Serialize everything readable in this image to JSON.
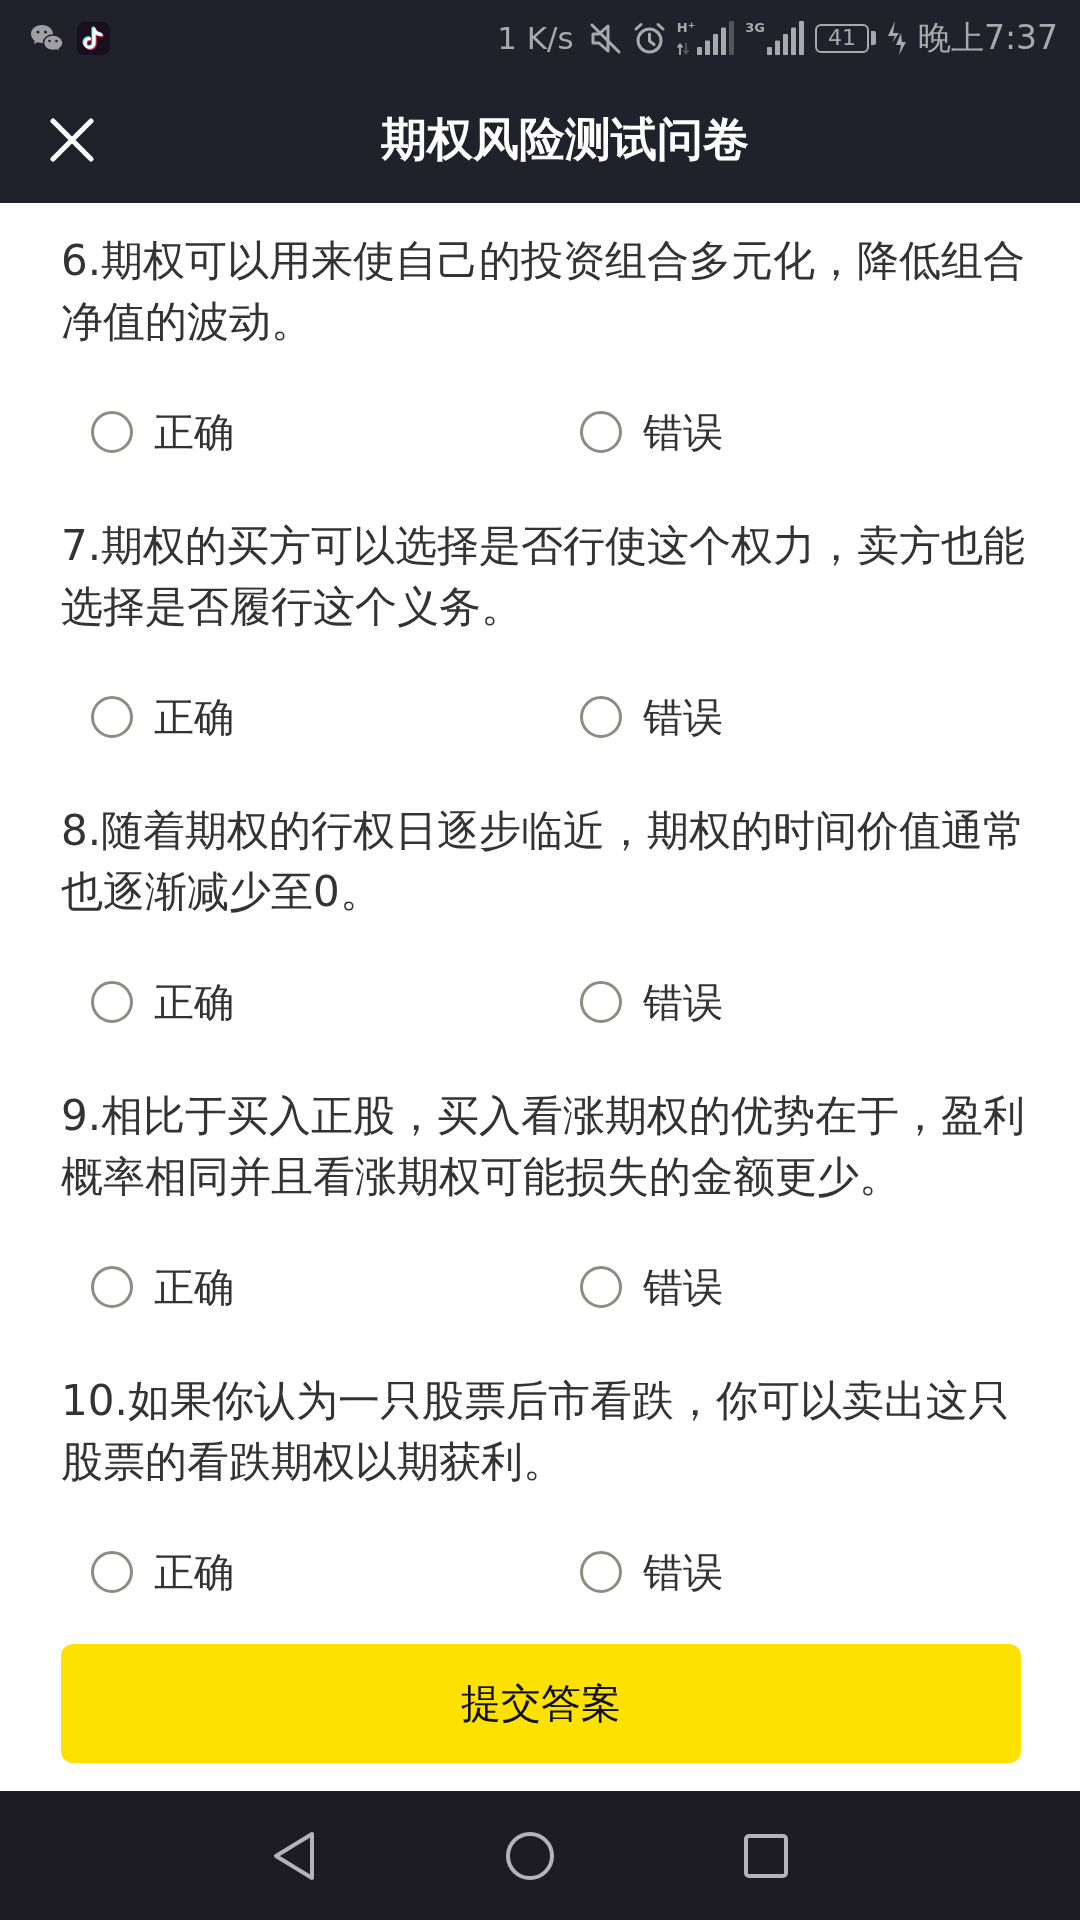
{
  "status_bar": {
    "speed": "1 K/s",
    "sim_1_network": "H$^{+}$",
    "sim_2_network": "3G",
    "battery": "41",
    "time": "晚上7:37"
  },
  "header": {
    "title": "期权风险测试问卷"
  },
  "questions": [
    {
      "text": "6.期权可以用来使自己的投资组合多元化，降低组合净值的波动。",
      "options": [
        {
          "label": "正确",
          "selected": false
        },
        {
          "label": "错误",
          "selected": false
        }
      ]
    },
    {
      "text": "7.期权的买方可以选择是否行使这个权力，卖方也能选择是否履行这个义务。",
      "options": [
        {
          "label": "正确",
          "selected": false
        },
        {
          "label": "错误",
          "selected": false
        }
      ]
    },
    {
      "text": "8.随着期权的行权日逐步临近，期权的时间价值通常也逐渐减少至0。",
      "options": [
        {
          "label": "正确",
          "selected": false
        },
        {
          "label": "错误",
          "selected": false
        }
      ]
    },
    {
      "text": "9.相比于买入正股，买入看涨期权的优势在于，盈利概率相同并且看涨期权可能损失的金额更少。",
      "options": [
        {
          "label": "正确",
          "selected": false
        },
        {
          "label": "错误",
          "selected": false
        }
      ]
    },
    {
      "text": "10.如果你认为一只股票后市看跌，你可以卖出这只股票的看跌期权以期获利。",
      "options": [
        {
          "label": "正确",
          "selected": false
        },
        {
          "label": "错误",
          "selected": false
        }
      ]
    }
  ],
  "submit_button": {
    "label": "提交答案"
  }
}
